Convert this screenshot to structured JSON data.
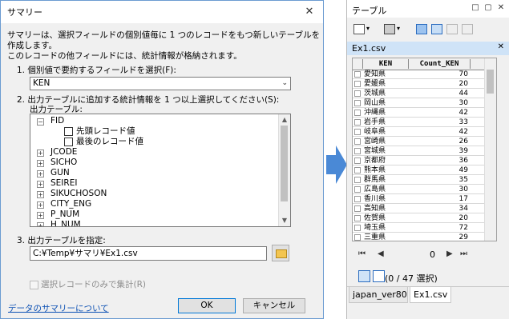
{
  "dialog": {
    "title": "サマリー",
    "description_line1": "サマリーは、選択フィールドの個別値毎に 1 つのレコードをもつ新しいテーブルを作成します。",
    "description_line2": "このレコードの他フィールドには、統計情報が格納されます。",
    "step1_label": "1.  個別値で要約するフィールドを選択(F):",
    "field_value": "KEN",
    "step2_label": "2.  出力テーブルに追加する統計情報を 1 つ以上選択してください(S):",
    "output_table_sublabel": "出力テーブル:",
    "tree": {
      "root": "FID",
      "children": [
        "先頭レコード値",
        "最後のレコード値"
      ],
      "fields": [
        "JCODE",
        "SICHO",
        "GUN",
        "SEIREI",
        "SIKUCHOSON",
        "CITY_ENG",
        "P_NUM",
        "H_NUM"
      ]
    },
    "step3_label": "3.  出力テーブルを指定:",
    "output_path": "C:¥Temp¥サマリ¥Ex1.csv",
    "selected_only_label": "選択レコードのみで集計(R)",
    "help_link": "データのサマリーについて",
    "ok_label": "OK",
    "cancel_label": "キャンセル"
  },
  "table_window": {
    "title": "テーブル",
    "tab_label": "Ex1.csv",
    "columns": [
      "KEN",
      "Count_KEN"
    ],
    "rows": [
      [
        "愛知県",
        "70"
      ],
      [
        "愛媛県",
        "20"
      ],
      [
        "茨城県",
        "44"
      ],
      [
        "岡山県",
        "30"
      ],
      [
        "沖縄県",
        "42"
      ],
      [
        "岩手県",
        "33"
      ],
      [
        "岐阜県",
        "42"
      ],
      [
        "宮崎県",
        "26"
      ],
      [
        "宮城県",
        "39"
      ],
      [
        "京都府",
        "36"
      ],
      [
        "熊本県",
        "49"
      ],
      [
        "群馬県",
        "35"
      ],
      [
        "広島県",
        "30"
      ],
      [
        "香川県",
        "17"
      ],
      [
        "高知県",
        "34"
      ],
      [
        "佐賀県",
        "20"
      ],
      [
        "埼玉県",
        "72"
      ],
      [
        "三重県",
        "29"
      ]
    ],
    "current_record": "0",
    "selection_status": "(0 / 47 選択)",
    "bottom_tabs": [
      "japan_ver80",
      "Ex1.csv"
    ]
  }
}
